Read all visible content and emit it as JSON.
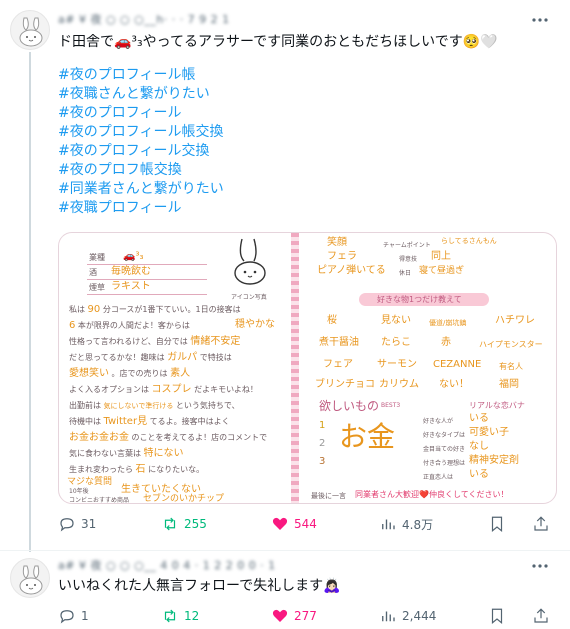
{
  "post1": {
    "author_blurred": "a# ¥ 夜 ○ ○ ○__h· · · 7 9 2 1",
    "text": "ド田舎で🚗³₃やってるアラサーです同業のおともだちほしいです🥺🤍",
    "hashtags": [
      "#夜のプロフィール帳",
      "#夜職さんと繋がりたい",
      "#夜のプロフィール",
      "#夜のプロフィール帳交換",
      "#夜のプロフィール交換",
      "#夜のプロフ帳交換",
      "#同業者さんと繋がりたい",
      "#夜職プロフィール"
    ],
    "actions": {
      "replies": "31",
      "reposts": "255",
      "likes": "544",
      "views": "4.8万"
    }
  },
  "media": {
    "left": {
      "rows": [
        {
          "label": "業種",
          "value": "🚗³₃"
        },
        {
          "label": "酒",
          "value": "毎晩飲む"
        },
        {
          "label": "煙草",
          "value": "ラキスト"
        }
      ],
      "icon_caption": "アイコン写真",
      "para_prefix": "私は",
      "para_parts": [
        {
          "pre": "私は",
          "fill": "90",
          "post": "分コースが1番下ていい。1日の接客は"
        },
        {
          "pre": "",
          "fill": "6",
          "post": "本が限界の人間だよ！客からは"
        },
        {
          "pre": "性格って言われるけど、自分では",
          "fill": "情緒不安定",
          "post": ""
        },
        {
          "pre": "だと思ってるかな！趣味は",
          "fill": "ガルパ",
          "post": "で特技は"
        },
        {
          "pre": "",
          "fill": "愛想笑い",
          "post": "。店での売りは"
        },
        {
          "pre": "よく入るオプションは",
          "fill": "コスプレ",
          "post": "だよキモいよね！"
        },
        {
          "pre": "出勤前は",
          "fill": "気にしないで準行ける",
          "post": "という気持ちで、"
        },
        {
          "pre": "待機中は",
          "fill": "Twitter見",
          "post": "てるよ。接客中はよく"
        },
        {
          "pre": "",
          "fill": "お金お金お金",
          "post": "のことを考えてるよ！店のコメントで"
        },
        {
          "pre": "気に食わない言葉は",
          "fill": "特にない",
          "post": ""
        },
        {
          "pre": "生まれ変わったら",
          "fill": "石",
          "post": "になりたいな。"
        }
      ],
      "para_fill_extra": "素人",
      "qa_title": "マジな質問",
      "qa": [
        {
          "label": "10年後",
          "value": "生きていたくない"
        },
        {
          "label": "コンビニおすすめ商品",
          "value": "セブンのいかチップ"
        }
      ]
    },
    "right": {
      "top_items": [
        {
          "label": "得意技",
          "value": "同上"
        },
        {
          "label": "休日",
          "value": "寝て昼過ぎ"
        }
      ],
      "top_values": [
        "笑顔",
        "フェラ",
        "ピアノ弾いてる",
        "らしてるさんもん",
        "同上",
        "寝てか目酔んでる"
      ],
      "charm_label": "チャームポイント",
      "favorites_title": "好きな物1つだけ教えて",
      "favorites": [
        "桜",
        "見ない",
        "優道/崩坑鎮",
        "ハチワレ",
        "煮干醤油",
        "たらこ",
        "赤",
        "ハイプモンスター",
        "フェア",
        "サーモン",
        "CEZANNE",
        "有名人",
        "ブリンチョコ",
        "カリウム",
        "ない！",
        "福岡"
      ],
      "wants_title": "欲しいもの",
      "wants_rank": "BEST3",
      "wants_main": "お金",
      "love_title": "リアルな恋バナ",
      "love_items": [
        {
          "label": "好きな人が",
          "value": "いる"
        },
        {
          "label": "好きなタイプは",
          "value": "可愛い子"
        },
        {
          "label": "金目当ての好き",
          "value": "なし"
        },
        {
          "label": "付き合う理想は",
          "value": "精神安定剤"
        },
        {
          "label": "正直恋人は",
          "value": "いる"
        }
      ],
      "last_label": "最後に一言",
      "last_value": "同業者さん大歓迎❤️仲良くしてください！"
    }
  },
  "post2": {
    "author_blurred": "a# ¥ 夜 ○ ○ ○__ 4 0 4 · 1 2 2 0 0 · 1",
    "text": "いいねくれた人無言フォローで失礼します🙇🏻‍♀️",
    "actions": {
      "replies": "1",
      "reposts": "12",
      "likes": "277",
      "views": "2,444"
    }
  }
}
